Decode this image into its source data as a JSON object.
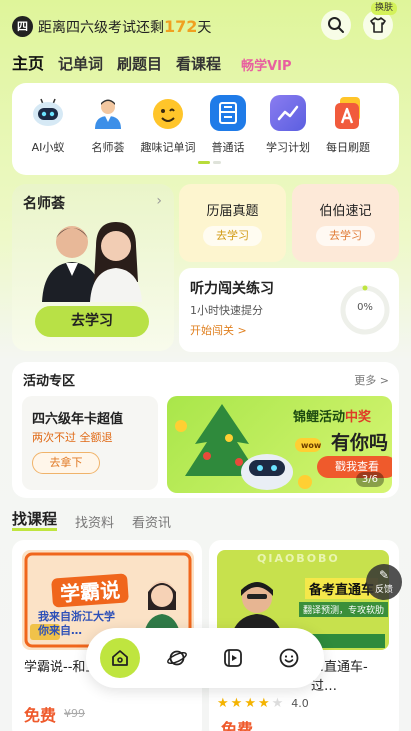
{
  "header": {
    "badge": "四",
    "countdown_prefix": "距离四六级考试还剩",
    "countdown_days": "172",
    "countdown_suffix": "天",
    "skin_tag": "换肤"
  },
  "main_nav": [
    {
      "label": "主页",
      "active": true
    },
    {
      "label": "记单词"
    },
    {
      "label": "刷题目"
    },
    {
      "label": "看课程"
    },
    {
      "label": "畅学VIP",
      "vip": true
    }
  ],
  "features": [
    {
      "label": "AI小蚁",
      "icon": "robot-icon"
    },
    {
      "label": "名师荟",
      "icon": "teacher-icon"
    },
    {
      "label": "趣味记单词",
      "icon": "smiley-icon"
    },
    {
      "label": "普通话",
      "icon": "mandarin-icon"
    },
    {
      "label": "学习计划",
      "icon": "chart-icon"
    },
    {
      "label": "每日刷题",
      "icon": "letter-a-icon"
    }
  ],
  "teacher_card": {
    "title": "名师荟",
    "button": "去学习"
  },
  "cards": {
    "exam": {
      "title": "历届真题",
      "button": "去学习"
    },
    "vocab": {
      "title": "伯伯速记",
      "button": "去学习"
    },
    "listening": {
      "title": "听力闯关练习",
      "subtitle": "1小时快速提分",
      "link": "开始闯关 >",
      "percent": "0%",
      "progress": 0
    }
  },
  "activity": {
    "title": "活动专区",
    "more": "更多 >",
    "promo": {
      "title": "四六级年卡超值",
      "subtitle": "两次不过 全额退",
      "button": "去拿下"
    },
    "banner": {
      "line1a": "锦鲤活动",
      "line1b": "中奖",
      "line2": "有你吗",
      "button": "戳我查看",
      "page": "3/6"
    }
  },
  "tabs": [
    {
      "label": "找课程",
      "active": true
    },
    {
      "label": "找资料"
    },
    {
      "label": "看资讯"
    }
  ],
  "courses": [
    {
      "thumb_title": "学霸说",
      "thumb_sub": "我来自浙江大学 你来自…",
      "title": "学霸说--和五…嘻!",
      "price": "免费",
      "orig_price": "¥99"
    },
    {
      "thumb_brand": "QIAOBOBO",
      "thumb_title": "备考直通车",
      "thumb_sub": "翻译预测，专攻软肋",
      "title": "…直通车-过…",
      "rating": "4.0",
      "stars": 4,
      "price": "免费"
    }
  ],
  "feedback": "反馈",
  "bottom_nav": [
    {
      "icon": "home-icon",
      "active": true
    },
    {
      "icon": "planet-icon"
    },
    {
      "icon": "video-icon"
    },
    {
      "icon": "profile-face-icon"
    }
  ]
}
